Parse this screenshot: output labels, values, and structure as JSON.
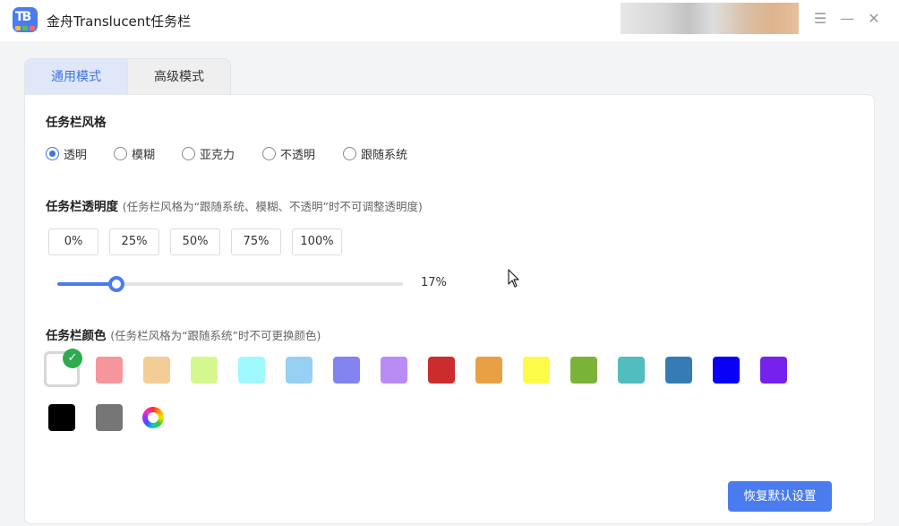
{
  "app": {
    "title": "金舟Translucent任务栏",
    "logo_text": "TB"
  },
  "window_controls": {
    "menu_icon": "menu-icon",
    "minimize_icon": "minimize-icon",
    "close_icon": "close-icon"
  },
  "tabs": [
    {
      "label": "通用模式",
      "active": true
    },
    {
      "label": "高级模式",
      "active": false
    }
  ],
  "style_section": {
    "title": "任务栏风格",
    "options": [
      {
        "label": "透明",
        "selected": true
      },
      {
        "label": "模糊",
        "selected": false
      },
      {
        "label": "亚克力",
        "selected": false
      },
      {
        "label": "不透明",
        "selected": false
      },
      {
        "label": "跟随系统",
        "selected": false
      }
    ]
  },
  "transparency_section": {
    "title": "任务栏透明度",
    "hint": "(任务栏风格为“跟随系统、模糊、不透明”时不可调整透明度)",
    "presets": [
      "0%",
      "25%",
      "50%",
      "75%",
      "100%"
    ],
    "slider_value": 17,
    "slider_label": "17%"
  },
  "color_section": {
    "title": "任务栏颜色",
    "hint": "(任务栏风格为“跟随系统”时不可更换颜色)",
    "swatches": [
      "#ffffff",
      "#f5969c",
      "#f2cd96",
      "#d5f88e",
      "#9ff8fb",
      "#96d0f2",
      "#8383f1",
      "#b98cf5",
      "#cc2c2c",
      "#e8a044",
      "#fcfb4a",
      "#7bb338",
      "#52bcbe",
      "#357cb5",
      "#0a00f5",
      "#7722ec",
      "#000000",
      "#767676"
    ],
    "selected_index": 0,
    "picker_icon": "color-wheel-icon",
    "check_icon": "check-icon"
  },
  "reset_button": {
    "label": "恢复默认设置"
  },
  "colors": {
    "accent": "#4a7cf0",
    "tab_active_bg": "#dfe7f8",
    "check_green": "#2fab4f"
  }
}
